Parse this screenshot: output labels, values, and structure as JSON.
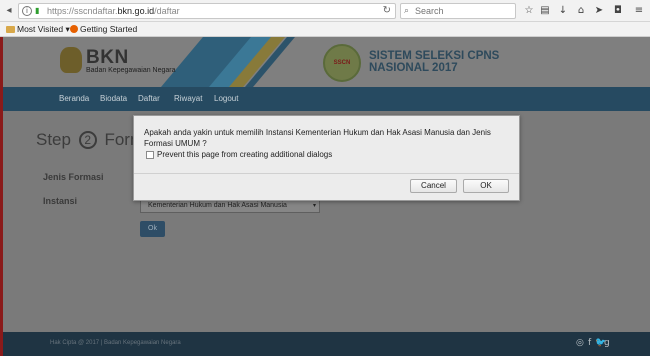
{
  "browser": {
    "url_prefix": "https://sscndaftar.",
    "url_domain": "bkn.go.id",
    "url_path": "/daftar",
    "search_placeholder": "Search",
    "bookmarks": [
      {
        "label": "Most Visited",
        "icon": "folder-icon",
        "has_dropdown": true
      },
      {
        "label": "Getting Started",
        "icon": "firefox-icon"
      }
    ]
  },
  "header": {
    "logo_text": "BKN",
    "logo_subtitle": "Badan Kepegawaian Negara",
    "badge_text": "SSCN",
    "title_line1": "SISTEM SELEKSI CPNS",
    "title_line2": "NASIONAL 2017"
  },
  "nav": {
    "items": [
      "Beranda",
      "Biodata",
      "Daftar",
      "Riwayat",
      "Logout"
    ]
  },
  "form": {
    "step_label": "Step",
    "step_number": "2",
    "step_title": "Form",
    "jenis_formasi_label": "Jenis Formasi",
    "instansi_label": "Instansi",
    "instansi_value": "Kementerian Hukum dan Hak Asasi Manusia",
    "ok_label": "Ok"
  },
  "footer": {
    "copyright": "Hak Cipta @ 2017 | Badan Kepegawaian Negara",
    "social_icons": [
      "whatsapp-icon",
      "facebook-icon",
      "twitter-icon",
      "google-plus-icon"
    ]
  },
  "dialog": {
    "message": "Apakah anda yakin untuk memilih Instansi Kementerian Hukum dan Hak Asasi Manusia dan Jenis Formasi UMUM ?",
    "checkbox_label": "Prevent this page from creating additional dialogs",
    "checkbox_checked": false,
    "cancel_label": "Cancel",
    "ok_label": "OK"
  },
  "colors": {
    "navbar": "#264a61",
    "footer": "#1f3443",
    "overlay_gray": "#7a7a7a",
    "dialog_bg": "#ececec"
  }
}
